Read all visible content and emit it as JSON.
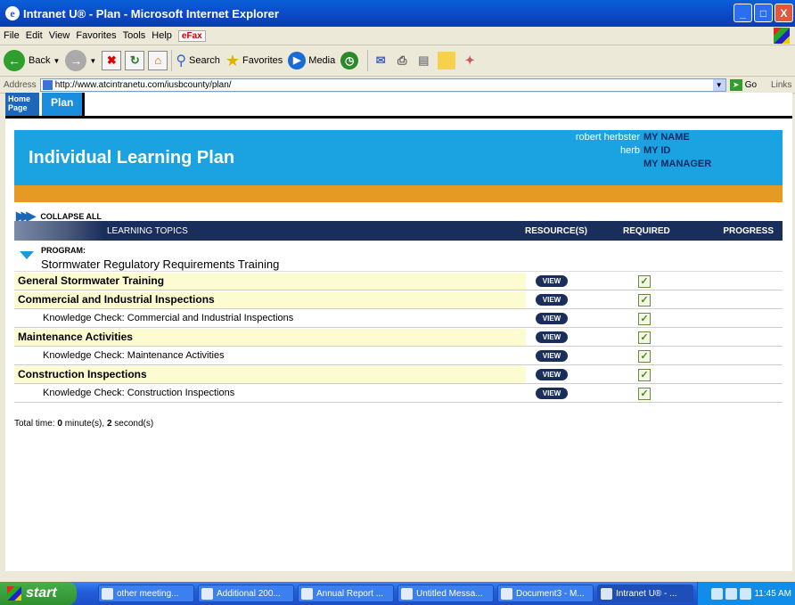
{
  "window": {
    "title": "Intranet U® - Plan - Microsoft Internet Explorer",
    "buttons": [
      "_",
      "□",
      "X"
    ]
  },
  "menu": [
    "File",
    "Edit",
    "View",
    "Favorites",
    "Tools",
    "Help"
  ],
  "menu_efax": "eFax",
  "toolbar": {
    "back": "Back",
    "search": "Search",
    "favorites": "Favorites",
    "media": "Media"
  },
  "address": {
    "label": "Address",
    "url": "http://www.atcintranetu.com/iusbcounty/plan/",
    "go": "Go",
    "links": "Links"
  },
  "apptabs": {
    "home": "Home Page",
    "plan": "Plan"
  },
  "banner": {
    "title": "Individual Learning Plan",
    "user_rows": [
      {
        "value": "robert herbster",
        "label": "MY NAME"
      },
      {
        "value": "herb",
        "label": "MY ID"
      },
      {
        "value": "",
        "label": "MY MANAGER"
      }
    ]
  },
  "collapse_all": "COLLAPSE ALL",
  "table_header": {
    "topics": "LEARNING TOPICS",
    "resources": "RESOURCE(S)",
    "required": "REQUIRED",
    "progress": "PROGRESS"
  },
  "program": {
    "label": "PROGRAM:",
    "name": "Stormwater Regulatory Requirements Training"
  },
  "rows": [
    {
      "type": "hdr",
      "name": "General Stormwater Training",
      "view": "VIEW",
      "required": "✓"
    },
    {
      "type": "hdr",
      "name": "Commercial and Industrial Inspections",
      "view": "VIEW",
      "required": "✓"
    },
    {
      "type": "sub",
      "name": "Knowledge Check: Commercial and Industrial Inspections",
      "view": "VIEW",
      "required": "✓"
    },
    {
      "type": "hdr",
      "name": "Maintenance Activities",
      "view": "VIEW",
      "required": "✓"
    },
    {
      "type": "sub",
      "name": "Knowledge Check: Maintenance Activities",
      "view": "VIEW",
      "required": "✓"
    },
    {
      "type": "hdr",
      "name": "Construction Inspections",
      "view": "VIEW",
      "required": "✓"
    },
    {
      "type": "sub",
      "name": "Knowledge Check: Construction Inspections",
      "view": "VIEW",
      "required": "✓"
    }
  ],
  "total_time": {
    "label": "Total time:",
    "minutes": "0",
    "minutes_unit": "minute(s),",
    "seconds": "2",
    "seconds_unit": "second(s)"
  },
  "taskbar": {
    "start": "start",
    "tasks": [
      {
        "label": "other meeting...",
        "active": false
      },
      {
        "label": "Additional 200...",
        "active": false
      },
      {
        "label": "Annual Report ...",
        "active": false
      },
      {
        "label": "Untitled Messa...",
        "active": false
      },
      {
        "label": "Document3 - M...",
        "active": false
      },
      {
        "label": "Intranet U® - ...",
        "active": true
      }
    ],
    "clock": "11:45 AM"
  }
}
